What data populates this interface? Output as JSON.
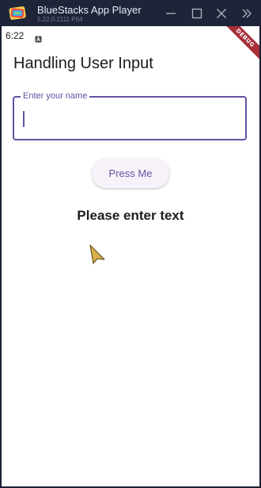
{
  "window": {
    "app_name": "BlueStacks App Player",
    "version": "5.22.0.2111  P64",
    "logo_icon": "bluestacks-logo-icon",
    "controls": [
      "minimize-icon",
      "maximize-icon",
      "close-icon",
      "expand-sidebar-icon"
    ]
  },
  "statusbar": {
    "time": "6:22",
    "notification_icon": "notification-icon"
  },
  "debug_banner": "DEBUG",
  "page": {
    "title": "Handling User Input",
    "name_field": {
      "label": "Enter your name",
      "value": ""
    },
    "button_label": "Press Me",
    "result_text": "Please enter text"
  },
  "colors": {
    "primary": "#6750a4",
    "titlebar": "#1e2538",
    "debug_ribbon": "#a8303a",
    "button_bg": "#f7f2fa",
    "cursor": "#d9b04a"
  }
}
